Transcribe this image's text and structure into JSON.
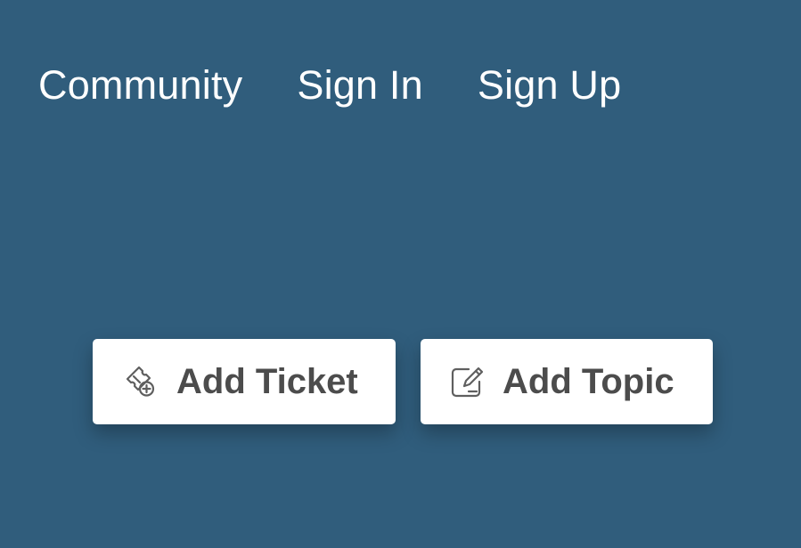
{
  "colors": {
    "background": "#305d7c",
    "nav_text": "#ffffff",
    "button_background": "#ffffff",
    "button_text": "#4c4c4c"
  },
  "nav": {
    "community_label": "Community",
    "sign_in_label": "Sign In",
    "sign_up_label": "Sign Up"
  },
  "actions": {
    "add_ticket_label": "Add Ticket",
    "add_ticket_icon": "ticket-add-icon",
    "add_topic_label": "Add Topic",
    "add_topic_icon": "edit-note-icon"
  }
}
